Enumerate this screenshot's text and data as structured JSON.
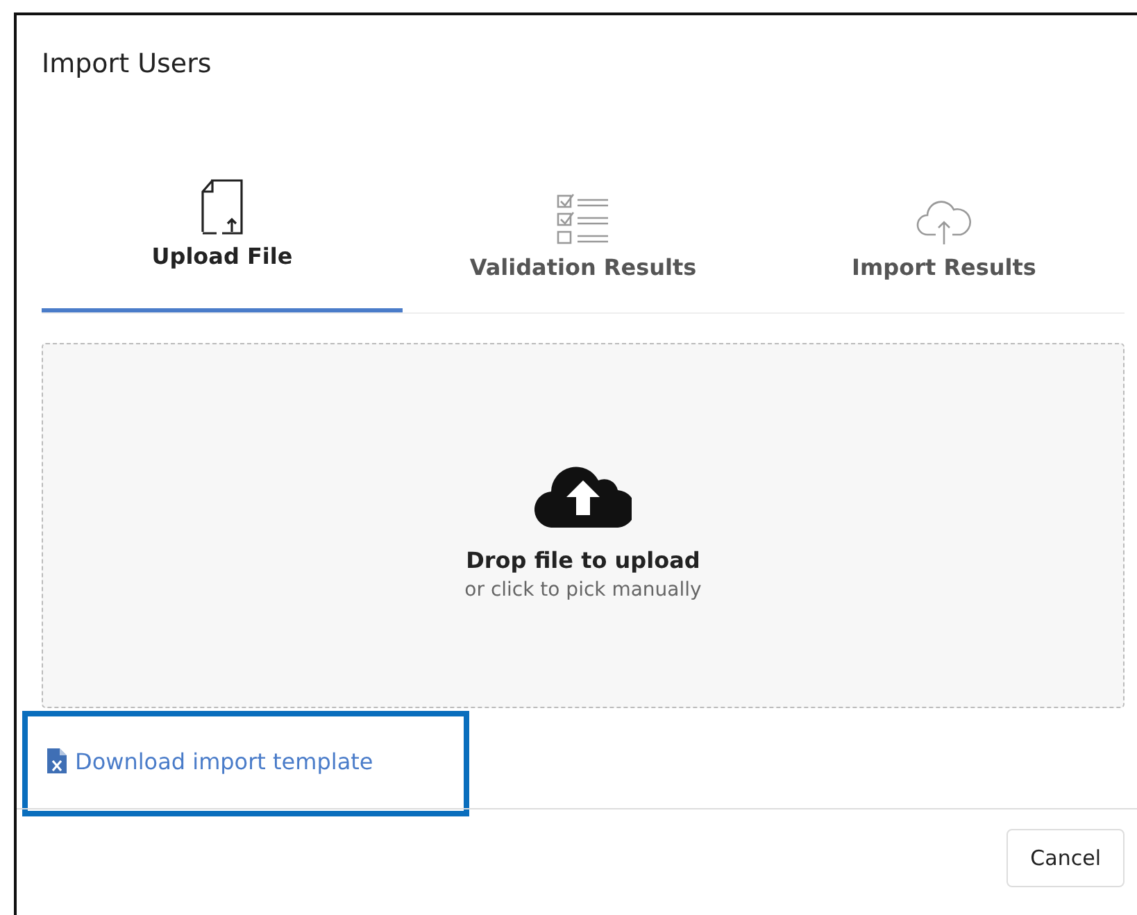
{
  "dialog": {
    "title": "Import Users"
  },
  "tabs": [
    {
      "label": "Upload File",
      "selected": true
    },
    {
      "label": "Validation Results",
      "selected": false
    },
    {
      "label": "Import Results",
      "selected": false
    }
  ],
  "dropzone": {
    "title": "Drop file to upload",
    "hint": "or click to pick manually"
  },
  "template_link": {
    "label": "Download import template",
    "highlighted": true
  },
  "buttons": [
    {
      "label": "Cancel"
    }
  ]
}
